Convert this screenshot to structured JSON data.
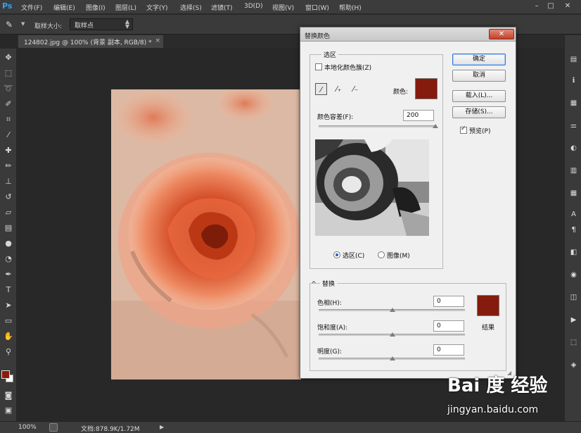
{
  "app": {
    "logo": "Ps",
    "menus": [
      "文件(F)",
      "编辑(E)",
      "图像(I)",
      "图层(L)",
      "文字(Y)",
      "选择(S)",
      "滤镜(T)",
      "3D(D)",
      "视图(V)",
      "窗口(W)",
      "帮助(H)"
    ],
    "window_controls": [
      "–",
      "□",
      "✕"
    ]
  },
  "options_bar": {
    "sample_size_label": "取样大小:",
    "sample_size_value": "取样点"
  },
  "document": {
    "tab_title": "124802.jpg @ 100% (背景 副本, RGB/8) *",
    "tab_close": "×"
  },
  "status": {
    "zoom": "100%",
    "doc_size": "文档:878.9K/1.72M"
  },
  "dialog": {
    "title": "替换颜色",
    "close": "✕",
    "selection": {
      "legend": "选区",
      "localized_label": "本地化颜色簇(Z)",
      "localized_checked": false,
      "color_label": "颜色:",
      "color": "#851b0d",
      "fuzziness_label": "颜色容差(F):",
      "fuzziness_value": "200",
      "fuzziness_fraction": 1.0,
      "view_selection": "选区(C)",
      "view_image": "图像(M)",
      "view_selected": "selection"
    },
    "buttons": {
      "ok": "确定",
      "cancel": "取消",
      "load": "载入(L)...",
      "save": "存储(S)..."
    },
    "preview": {
      "label": "预览(P)",
      "checked": true
    },
    "replacement": {
      "legend": "替换",
      "hue_label": "色相(H):",
      "hue_value": "0",
      "saturation_label": "饱和度(A):",
      "saturation_value": "0",
      "lightness_label": "明度(G):",
      "lightness_value": "0",
      "result_label": "结果",
      "result_color": "#851b0d"
    }
  },
  "watermark": {
    "logo": "Bai 度 经验",
    "url": "jingyan.baidu.com"
  }
}
